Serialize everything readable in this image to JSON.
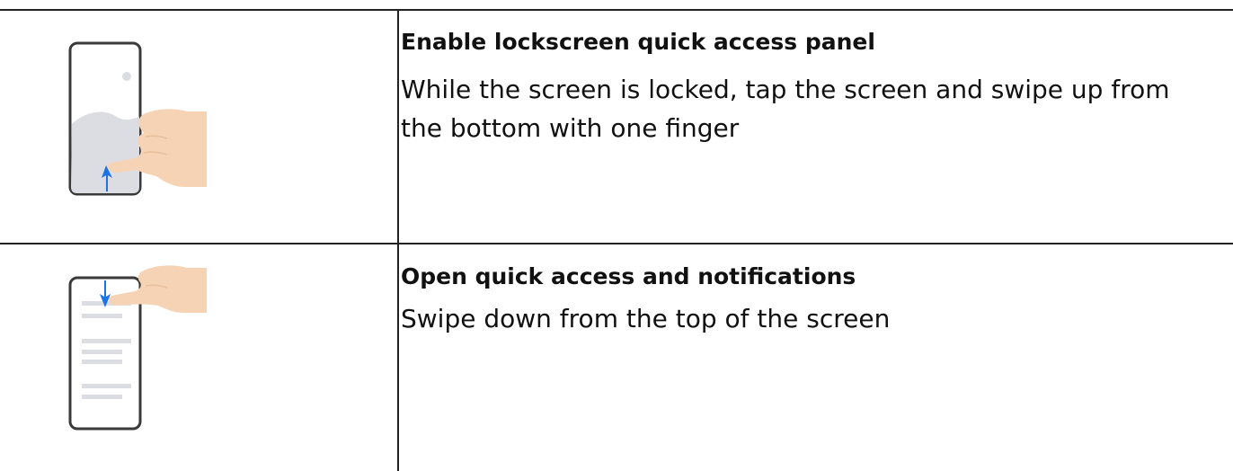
{
  "steps": [
    {
      "title": "Enable lockscreen quick access panel",
      "description": "While the screen is locked, tap the screen and swipe up from the bottom with one finger",
      "illustration": "phone-swipe-up-from-bottom"
    },
    {
      "title": "Open quick access and notifications",
      "description": "Swipe down from the top of the screen",
      "illustration": "phone-swipe-down-from-top"
    }
  ],
  "colors": {
    "border": "#222222",
    "phone_frame": "#3a3a3a",
    "landscape": "#dcdde3",
    "hand": "#f6d3b5",
    "arrow": "#1a73e8",
    "list_lines": "#dcdde3"
  }
}
